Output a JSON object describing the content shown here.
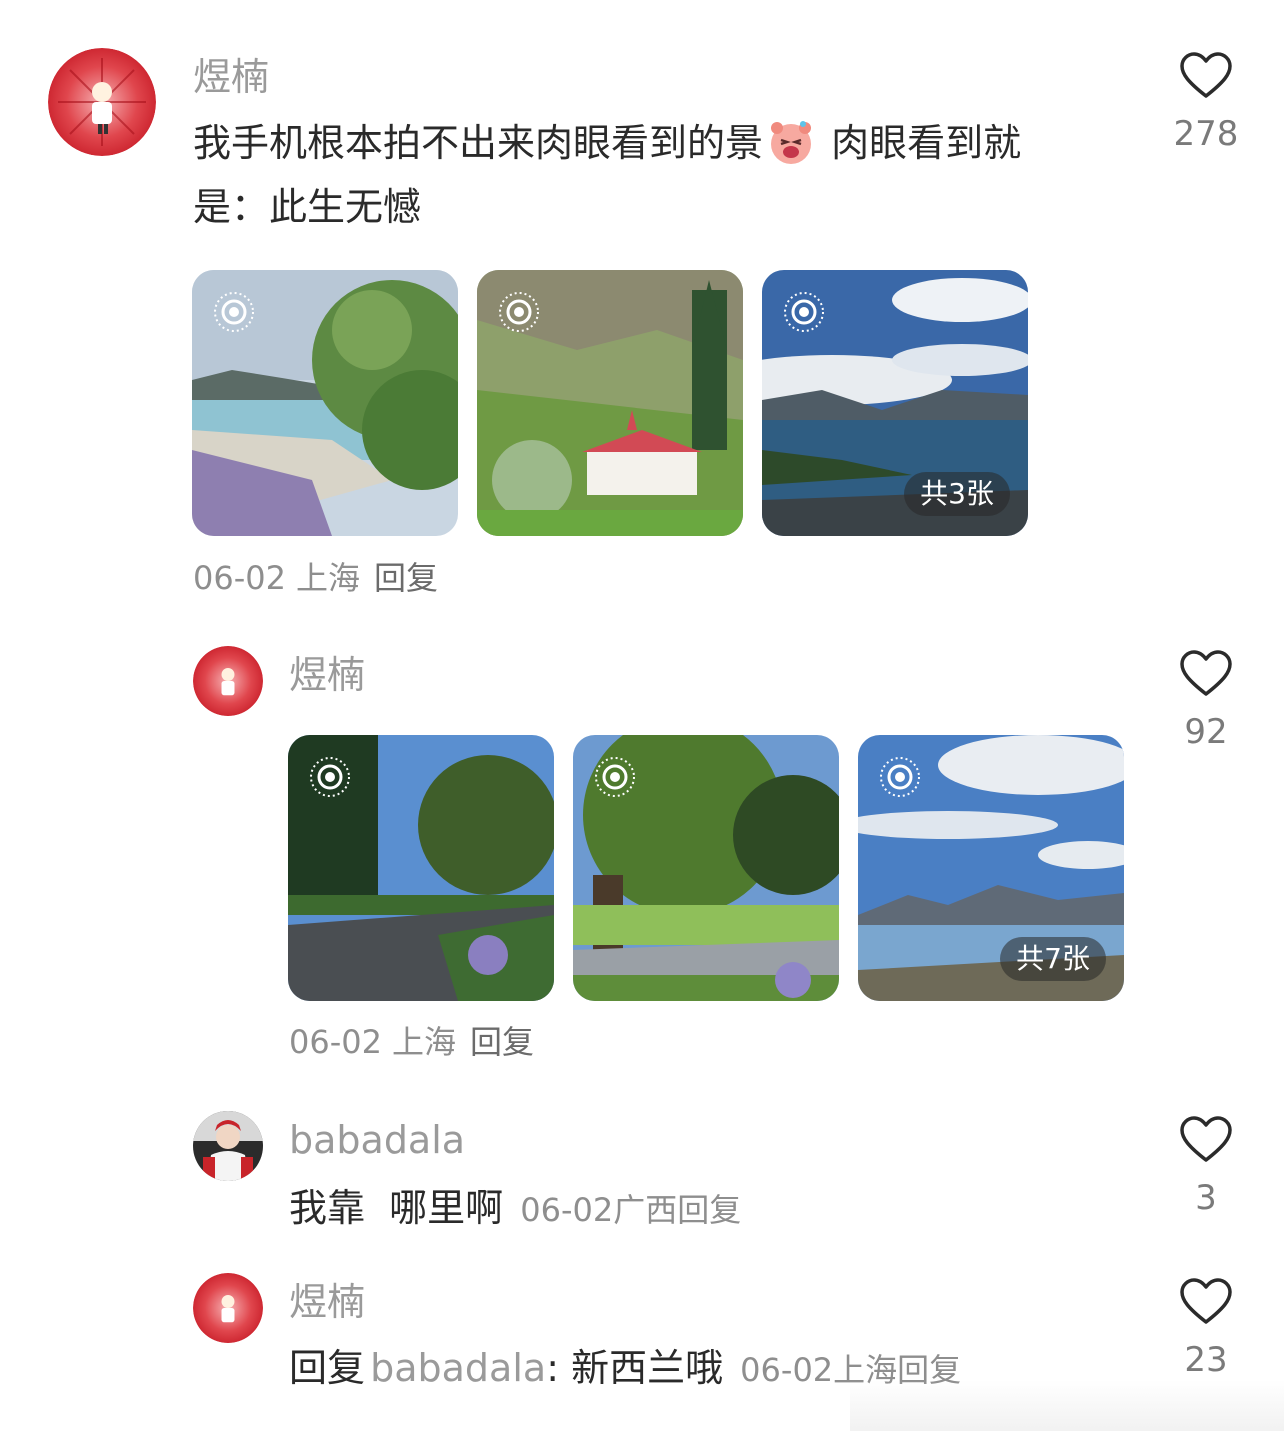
{
  "comments": [
    {
      "username": "煜楠",
      "text_part1": "我手机根本拍不出来肉眼看到的景",
      "text_part2": " 肉眼看到就",
      "text_line2": "是：此生无憾",
      "emoji": "laughing-pig-emoji",
      "photos_badge": "共3张",
      "date": "06-02",
      "location": "上海",
      "reply_label": "回复",
      "likes": "278"
    },
    {
      "username": "煜楠",
      "photos_badge": "共7张",
      "date": "06-02",
      "location": "上海",
      "reply_label": "回复",
      "likes": "92"
    },
    {
      "username": "babadala",
      "text": "我靠  哪里啊",
      "date": "06-02",
      "location": "广西",
      "reply_label": "回复",
      "likes": "3"
    },
    {
      "username": "煜楠",
      "reply_prefix": "回复",
      "reply_to": "babadala",
      "reply_text": ": 新西兰哦",
      "date": "06-02",
      "location": "上海",
      "reply_label": "回复",
      "likes": "23"
    }
  ],
  "icons": {
    "like": "heart-outline-icon",
    "live_photo": "live-photo-icon"
  },
  "colors": {
    "username": "#9a9a9a",
    "meta": "#8e8e8e",
    "text": "#2a2a2a",
    "avatar_red": "#d9313a"
  }
}
